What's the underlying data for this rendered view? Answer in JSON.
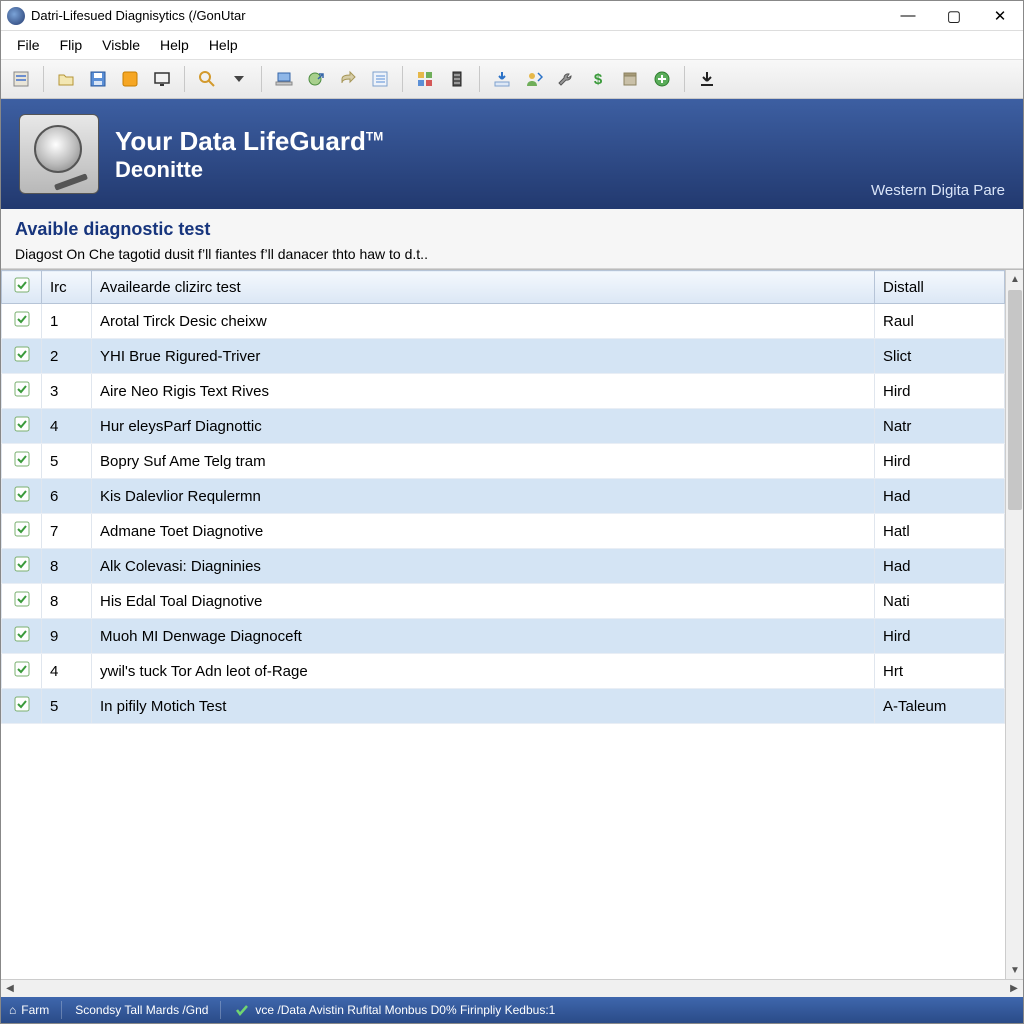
{
  "titlebar": {
    "title": "Datri-Lifesued Diagnisytics (/GonUtar"
  },
  "menubar": [
    "File",
    "Flip",
    "Visble",
    "Help",
    "Help"
  ],
  "toolbar_icons": [
    "properties-icon",
    "open-icon",
    "save-icon",
    "orange-box-icon",
    "monitor-outline-icon",
    "search-icon",
    "dropdown-icon",
    "laptop-icon",
    "globe-arrow-icon",
    "arrow-right-icon",
    "list-icon",
    "grid-icon",
    "rack-icon",
    "download-icon",
    "user-import-icon",
    "wrench-icon",
    "dollar-icon",
    "box-icon",
    "plus-circle-icon",
    "download-arrow-icon"
  ],
  "banner": {
    "line1_a": "Your Data Life",
    "line1_b": "Guard",
    "tm": "TM",
    "line2": "Deonitte",
    "brand": "Western Digita Pare"
  },
  "section": {
    "title": "Avaible diagnostic test",
    "desc": "Diagost On Che tagotid dusit f’ll fiantes f’ll danacer thto haw to d.t.."
  },
  "columns": {
    "chk": "✔",
    "idx": "Irc",
    "name": "Availearde clizirc test",
    "status": "Distall"
  },
  "rows": [
    {
      "idx": "1",
      "name": "Arotal Tirck Desic cheixw",
      "status": "Raul"
    },
    {
      "idx": "2",
      "name": "YHI Brue Rigured-Triver",
      "status": "Slict"
    },
    {
      "idx": "3",
      "name": "Aire Neo Rigis Text Rives",
      "status": "Hird"
    },
    {
      "idx": "4",
      "name": "Hur eleysParf Diagnottic",
      "status": "Natr"
    },
    {
      "idx": "5",
      "name": "Bopry Suf Ame Telg tram",
      "status": "Hird"
    },
    {
      "idx": "6",
      "name": "Kis Dalevlior Requlermn",
      "status": "Had"
    },
    {
      "idx": "7",
      "name": "Admane Toet Diagnotive",
      "status": "Hatl"
    },
    {
      "idx": "8",
      "name": "Alk Colevasi: Diagninies",
      "status": "Had"
    },
    {
      "idx": "8",
      "name": "His Edal Toal Diagnotive",
      "status": "Nati"
    },
    {
      "idx": "9",
      "name": "Muoh MI Denwage Diagnoceft",
      "status": "Hird"
    },
    {
      "idx": "4",
      "name": "ywil's tuck Tor Adn leot of-Rage",
      "status": "Hrt"
    },
    {
      "idx": "5",
      "name": "In pifily Motich Test",
      "status": "A-Taleum"
    }
  ],
  "status": {
    "p1": "Farm",
    "p2": "Scondsy Tall Mards /Gnd",
    "p3": "vce /Data Avistin Rufital Monbus D0% Firinpliy Kedbus:1"
  }
}
